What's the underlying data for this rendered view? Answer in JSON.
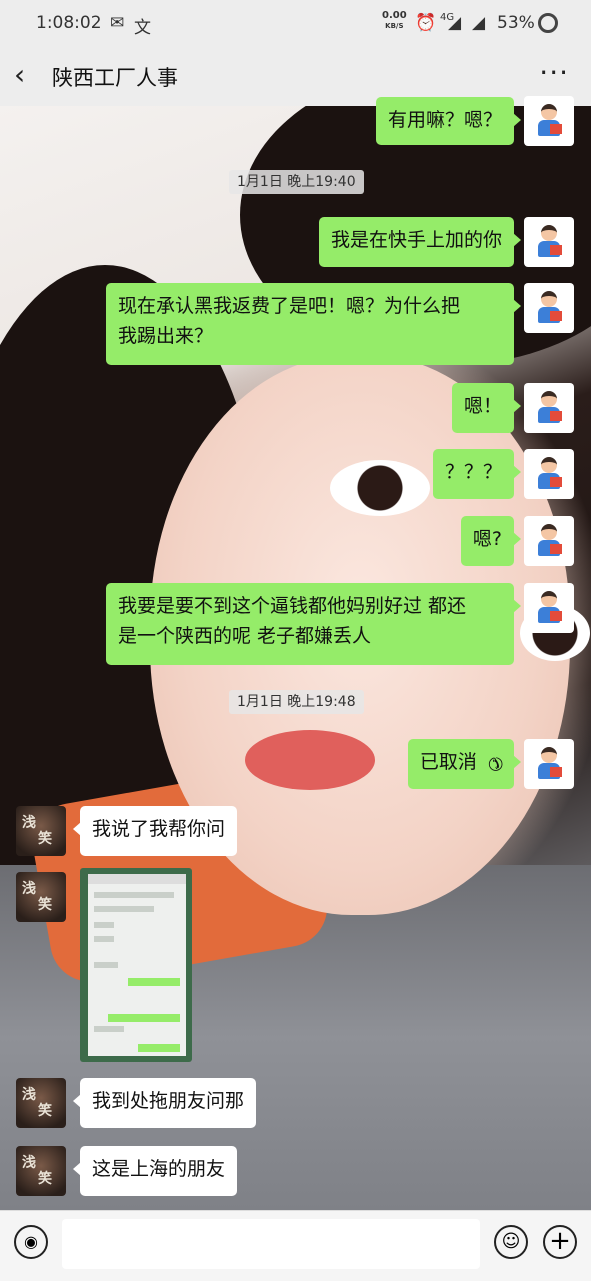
{
  "status_bar": {
    "time": "1:08:02",
    "net_speed": "0.00",
    "net_unit": "KB/S",
    "net_type": "4G",
    "battery": "53%"
  },
  "header": {
    "title": "陕西工厂人事",
    "back_icon": "chevron-left-icon",
    "more_label": "···"
  },
  "messages": {
    "m1": "有用嘛？嗯？",
    "ts1": "1月1日 晚上19:40",
    "m2": "我是在快手上加的你",
    "m3_line1": "现在承认黑我返费了是吧！嗯？为什么把",
    "m3_line2": "我踢出来？",
    "m4": "嗯！",
    "m5": "？？？",
    "m6": "嗯?",
    "m7_line1": "我要是要不到这个逼钱都他妈别好过 都还",
    "m7_line2": "是一个陕西的呢 老子都嫌丢人",
    "ts2": "1月1日 晚上19:48",
    "m8": "已取消",
    "m9": "我说了我帮你问",
    "m10": "我到处拖朋友问那",
    "m11": "这是上海的朋友"
  },
  "avatar_other_text": {
    "line1": "浅",
    "line2": "笑"
  },
  "colors": {
    "sent_bubble": "#95ec69",
    "received_bubble": "#ffffff",
    "bar_bg": "#ededed"
  }
}
